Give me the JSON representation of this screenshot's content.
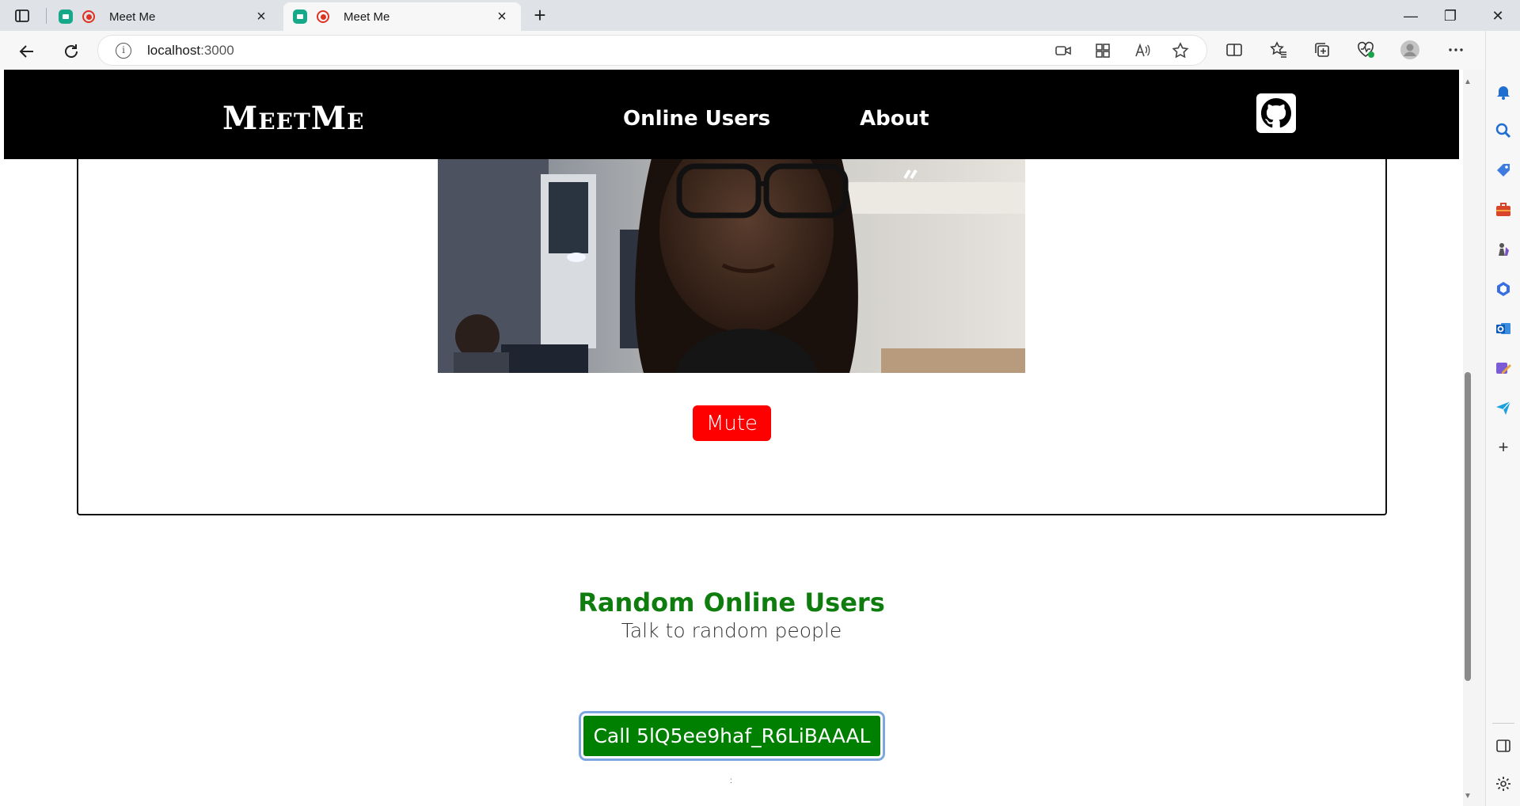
{
  "browser": {
    "tabs": [
      {
        "title": "Meet Me",
        "active": false
      },
      {
        "title": "Meet Me",
        "active": true
      }
    ],
    "new_tab_label": "+",
    "address": {
      "host": "localhost",
      "port": ":3000"
    },
    "info_glyph": "i",
    "icons": {
      "tab_actions": "tab-actions-icon",
      "back": "back-arrow-icon",
      "refresh": "refresh-icon",
      "camera": "video-camera-icon",
      "apps": "apps-icon",
      "read_aloud": "read-aloud-icon",
      "favorite": "star-icon",
      "split": "split-screen-icon",
      "favorites": "favorites-icon",
      "collections": "collections-icon",
      "health": "browser-essentials-icon",
      "profile": "profile-icon",
      "menu": "more-icon",
      "bing": "bing-copilot-icon"
    },
    "window_controls": {
      "minimize": "—",
      "restore": "❐",
      "close": "✕"
    },
    "colors": {
      "tab_strip": "#dfe3e8",
      "toolbar": "#f7f7f7"
    }
  },
  "site": {
    "logo": "MeetMe",
    "nav": {
      "online_users": "Online Users",
      "about": "About"
    },
    "video_controls": {
      "mute_label": "Mute"
    },
    "random": {
      "title": "Random Online Users",
      "subtitle": "Talk to random people",
      "call_label": "Call 5lQ5ee9haf_R6LiBAAAL"
    },
    "footer_dot": ":",
    "colors": {
      "nav_bg": "#000000",
      "mute": "#ff0000",
      "call": "#008000",
      "title": "#0e7d0e"
    }
  }
}
